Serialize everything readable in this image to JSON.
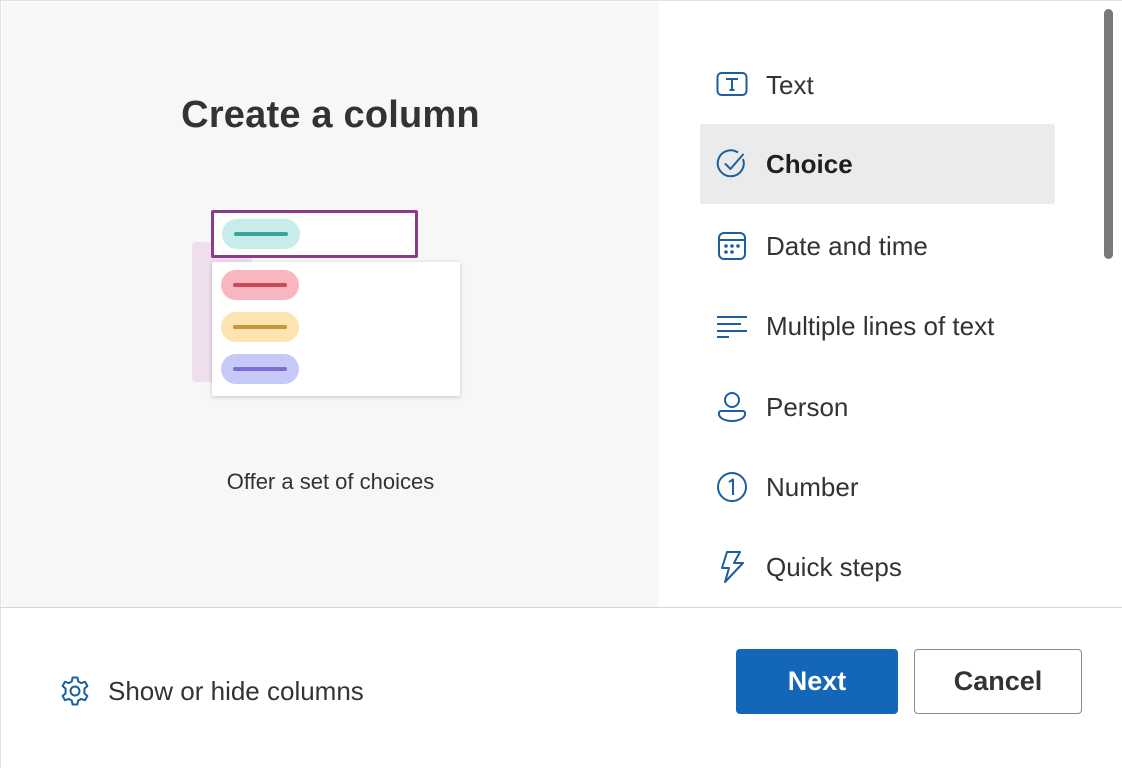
{
  "dialog": {
    "title": "Create a column",
    "description": "Offer a set of choices"
  },
  "column_types": [
    {
      "label": "Text",
      "icon": "text-box-icon",
      "selected": false
    },
    {
      "label": "Choice",
      "icon": "check-circle-icon",
      "selected": true
    },
    {
      "label": "Date and time",
      "icon": "calendar-icon",
      "selected": false
    },
    {
      "label": "Multiple lines of text",
      "icon": "multiline-text-icon",
      "selected": false
    },
    {
      "label": "Person",
      "icon": "person-icon",
      "selected": false
    },
    {
      "label": "Number",
      "icon": "number-circle-icon",
      "selected": false
    },
    {
      "label": "Quick steps",
      "icon": "lightning-icon",
      "selected": false
    }
  ],
  "footer": {
    "show_hide_label": "Show or hide columns",
    "next_label": "Next",
    "cancel_label": "Cancel"
  },
  "colors": {
    "accent": "#1467b8",
    "icon": "#1c5f9c",
    "selected_bg": "#ebebeb",
    "illustration_border": "#8a3c89"
  }
}
